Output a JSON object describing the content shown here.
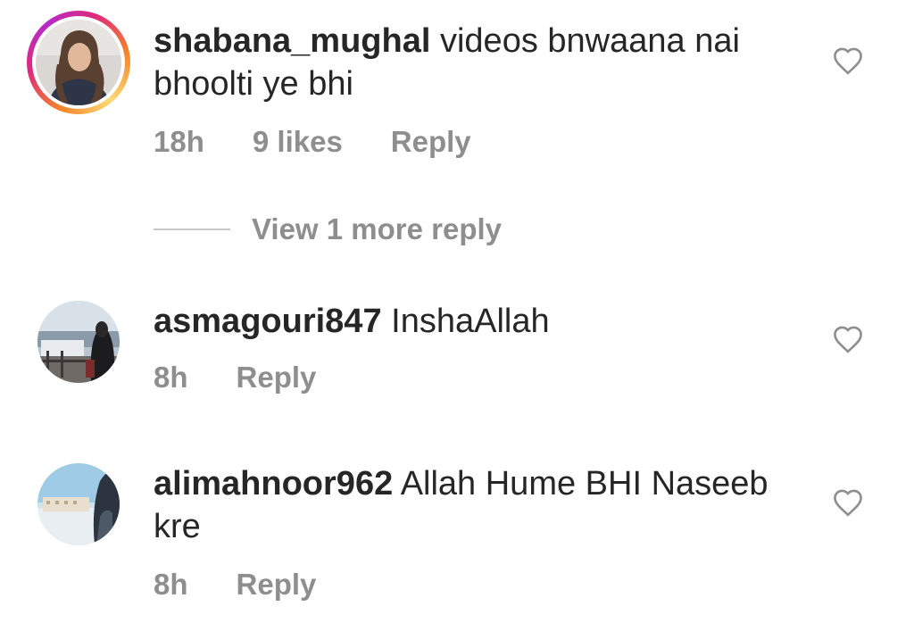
{
  "comments": [
    {
      "username": "shabana_mughal",
      "text": "videos bnwaana nai bhoolti ye bhi",
      "time": "18h",
      "likes": "9 likes",
      "reply": "Reply"
    },
    {
      "username": "asmagouri847",
      "text": "InshaAllah",
      "time": "8h",
      "reply": "Reply"
    },
    {
      "username": "alimahnoor962",
      "text": "Allah Hume BHI Naseeb kre",
      "time": "8h",
      "reply": "Reply"
    }
  ],
  "view_more_replies": "View 1 more reply",
  "icons": {
    "like": "heart-outline-icon",
    "story_ring": "story-ring-gradient"
  },
  "colors": {
    "text_primary": "#262626",
    "text_secondary": "#8e8e8e",
    "divider": "#c7c7c7",
    "story_ring_start": "#f58529",
    "story_ring_end": "#dd2a7b"
  }
}
